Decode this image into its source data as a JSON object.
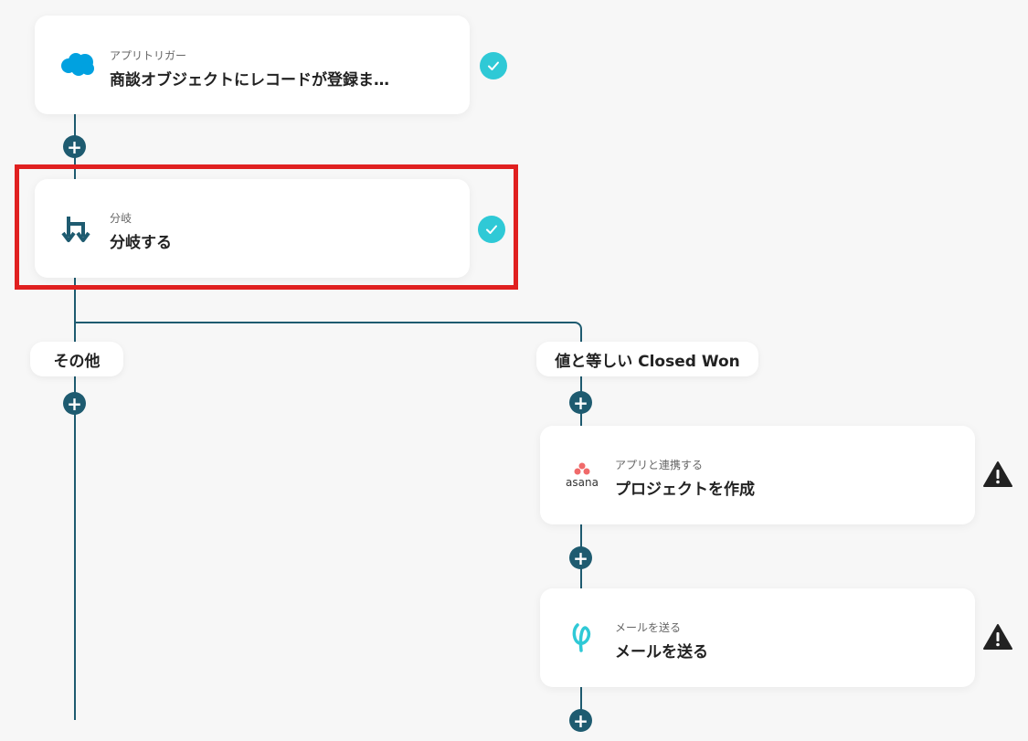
{
  "trigger": {
    "sub": "アプリトリガー",
    "title": "商談オブジェクトにレコードが登録ま…",
    "icon": "salesforce-cloud-icon"
  },
  "branch": {
    "sub": "分岐",
    "title": "分岐する",
    "icon": "branch-icon"
  },
  "labels": {
    "other": "その他",
    "condition": "値と等しい Closed Won"
  },
  "asana_step": {
    "logo_text": "asana",
    "sub": "アプリと連携する",
    "title": "プロジェクトを作成",
    "icon": "asana-logo-icon"
  },
  "mail_step": {
    "sub": "メールを送る",
    "title": "メールを送る",
    "icon": "mail-logo-icon"
  },
  "colors": {
    "line": "#1e5b70",
    "check": "#2fc9d6",
    "highlight": "#e02020",
    "background": "#f7f7f7"
  }
}
